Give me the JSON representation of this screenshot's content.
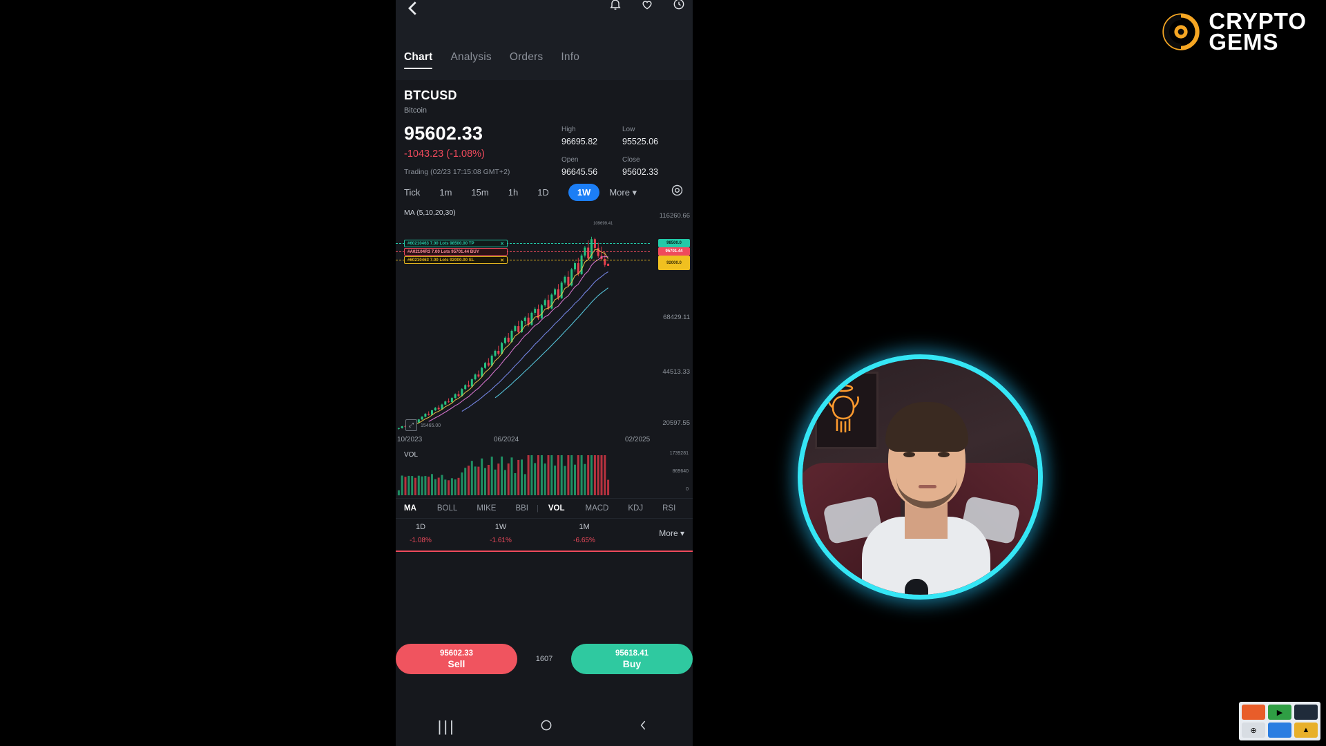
{
  "app": {
    "nav_back_icon": "chevron-left-icon",
    "top_icons": [
      "bell-icon",
      "heart-icon",
      "share-icon"
    ]
  },
  "tabs": [
    {
      "label": "Chart",
      "active": true
    },
    {
      "label": "Analysis",
      "active": false
    },
    {
      "label": "Orders",
      "active": false
    },
    {
      "label": "Info",
      "active": false
    }
  ],
  "symbol": {
    "ticker": "BTCUSD",
    "name": "Bitcoin",
    "last_price": "95602.33",
    "change": "-1043.23 (-1.08%)",
    "change_color": "#ef4a5c",
    "status": "Trading (02/23 17:15:08 GMT+2)"
  },
  "stats": {
    "high_label": "High",
    "high_value": "96695.82",
    "low_label": "Low",
    "low_value": "95525.06",
    "open_label": "Open",
    "open_value": "96645.56",
    "close_label": "Close",
    "close_value": "95602.33"
  },
  "timeframes": [
    {
      "label": "Tick",
      "active": false
    },
    {
      "label": "1m",
      "active": false
    },
    {
      "label": "15m",
      "active": false
    },
    {
      "label": "1h",
      "active": false
    },
    {
      "label": "1D",
      "active": false
    },
    {
      "label": "1W",
      "active": true
    },
    {
      "label": "More ▾",
      "active": false
    }
  ],
  "settings_icon": "gear-icon",
  "chart": {
    "ma_label": "MA (5,10,20,30)",
    "y_ticks": [
      "116260.66",
      "68429.11",
      "44513.33",
      "20597.55"
    ],
    "x_ticks": [
      "10/2023",
      "06/2024",
      "02/2025"
    ],
    "high_marker": "109699.41",
    "low_marker": "15465.00",
    "expand_icon": "expand-icon",
    "orders": [
      {
        "text": "#60210463  7.00 Lots  98500.00  TP",
        "price_tag": "98500.0",
        "type": "tp",
        "close_icon": "close-icon"
      },
      {
        "text": "#A02104R3  7.00 Lots  95701.44  BUY",
        "price_tag": "95701.44",
        "type": "buy",
        "close_icon": "close-icon"
      },
      {
        "text": "#60210463  7.00 Lots  92000.00  SL",
        "price_tag": "92000.0",
        "type": "sl",
        "close_icon": "close-icon"
      }
    ]
  },
  "volume": {
    "label": "VOL",
    "y_ticks": [
      "1739281",
      "869640",
      "0"
    ]
  },
  "indicators": [
    {
      "label": "MA",
      "active": true
    },
    {
      "label": "BOLL",
      "active": false
    },
    {
      "label": "MIKE",
      "active": false
    },
    {
      "label": "BBI",
      "active": false
    },
    {
      "label": "VOL",
      "active": true
    },
    {
      "label": "MACD",
      "active": false
    },
    {
      "label": "KDJ",
      "active": false
    },
    {
      "label": "RSI",
      "active": false
    }
  ],
  "performance": [
    {
      "period": "1D",
      "value": "-1.08%"
    },
    {
      "period": "1W",
      "value": "-1.61%"
    },
    {
      "period": "1M",
      "value": "-6.65%"
    }
  ],
  "performance_more": "More ▾",
  "actions": {
    "sell_price": "95602.33",
    "sell_label": "Sell",
    "buy_price": "95618.41",
    "buy_label": "Buy",
    "spread": "1607",
    "trend_icon": "trend-up-icon"
  },
  "system_nav": [
    "recents-icon",
    "home-icon",
    "back-icon"
  ],
  "branding": {
    "line1": "CRYPTO",
    "line2": "GEMS",
    "mark_icon": "gem-coin-icon",
    "accent": "#f5a623"
  },
  "webcam": {
    "label": "presenter-webcam",
    "ring_color": "#35e6f5"
  },
  "taskbar_icons": [
    "app-icon-1",
    "app-icon-2",
    "app-icon-3",
    "app-icon-4",
    "app-icon-5",
    "app-icon-6"
  ],
  "chart_data": {
    "type": "candlestick",
    "title": "BTCUSD 1W",
    "xlabel": "",
    "ylabel": "",
    "ylim": [
      15465.0,
      116260.66
    ],
    "y_ticks": [
      116260.66,
      68429.11,
      44513.33,
      20597.55
    ],
    "x_ticks": [
      "10/2023",
      "06/2024",
      "02/2025"
    ],
    "grid": false,
    "legend": "MA (5,10,20,30)",
    "annotations": [
      {
        "text": "109699.41",
        "type": "swing-high"
      },
      {
        "text": "15465.00",
        "type": "swing-low"
      },
      {
        "text": "TP 98500.00",
        "type": "take-profit-line"
      },
      {
        "text": "BUY 95701.44",
        "type": "entry-line"
      },
      {
        "text": "SL 92000.00",
        "type": "stop-loss-line"
      }
    ],
    "ohlc": [
      [
        16900,
        17400,
        16500,
        17200
      ],
      [
        17200,
        18300,
        17000,
        18100
      ],
      [
        18100,
        18800,
        17600,
        17900
      ],
      [
        17900,
        19200,
        17700,
        19000
      ],
      [
        19000,
        20400,
        18800,
        20200
      ],
      [
        20200,
        21000,
        19600,
        19900
      ],
      [
        19900,
        21600,
        19700,
        21400
      ],
      [
        21400,
        23000,
        21100,
        22700
      ],
      [
        22700,
        24500,
        22400,
        24100
      ],
      [
        24100,
        25300,
        23200,
        23600
      ],
      [
        23600,
        26100,
        23400,
        25800
      ],
      [
        25800,
        27400,
        25500,
        27000
      ],
      [
        27000,
        28200,
        25900,
        26300
      ],
      [
        26300,
        29000,
        26100,
        28600
      ],
      [
        28600,
        30500,
        28300,
        30100
      ],
      [
        30100,
        31600,
        29400,
        29800
      ],
      [
        29800,
        32200,
        29500,
        31800
      ],
      [
        31800,
        34000,
        31400,
        33600
      ],
      [
        33600,
        35200,
        32200,
        32700
      ],
      [
        32700,
        36500,
        32400,
        36100
      ],
      [
        36100,
        38400,
        35700,
        38000
      ],
      [
        38000,
        40100,
        36900,
        37300
      ],
      [
        37300,
        41200,
        37000,
        40800
      ],
      [
        40800,
        43600,
        40300,
        43100
      ],
      [
        43100,
        45000,
        41600,
        42100
      ],
      [
        42100,
        46800,
        41800,
        46300
      ],
      [
        46300,
        49200,
        45800,
        48700
      ],
      [
        48700,
        51000,
        46900,
        47400
      ],
      [
        47400,
        52800,
        47100,
        52200
      ],
      [
        52200,
        55100,
        51600,
        54500
      ],
      [
        54500,
        57000,
        52300,
        53100
      ],
      [
        53100,
        58900,
        52800,
        58300
      ],
      [
        58300,
        61500,
        57700,
        60900
      ],
      [
        60900,
        63200,
        58100,
        58900
      ],
      [
        58900,
        64800,
        58500,
        64200
      ],
      [
        64200,
        67100,
        63500,
        66500
      ],
      [
        66500,
        69000,
        62900,
        63600
      ],
      [
        63600,
        69500,
        63200,
        68900
      ],
      [
        68900,
        71200,
        67400,
        70600
      ],
      [
        70600,
        72800,
        66300,
        67100
      ],
      [
        67100,
        73500,
        66700,
        72900
      ],
      [
        72900,
        75600,
        71800,
        74800
      ],
      [
        74800,
        76900,
        69500,
        70300
      ],
      [
        70300,
        77200,
        69900,
        76500
      ],
      [
        76500,
        79800,
        75700,
        79100
      ],
      [
        79100,
        81600,
        74200,
        75000
      ],
      [
        75000,
        82400,
        74600,
        81700
      ],
      [
        81700,
        85000,
        80900,
        84300
      ],
      [
        84300,
        86800,
        79100,
        80000
      ],
      [
        80000,
        88200,
        79600,
        87500
      ],
      [
        87500,
        91000,
        86600,
        90300
      ],
      [
        90300,
        93100,
        85200,
        86100
      ],
      [
        86100,
        94600,
        85700,
        93900
      ],
      [
        93900,
        97800,
        92800,
        96900
      ],
      [
        96900,
        99500,
        90700,
        91600
      ],
      [
        91600,
        101400,
        91200,
        100600
      ],
      [
        100600,
        105200,
        99700,
        104400
      ],
      [
        104400,
        107900,
        98300,
        99200
      ],
      [
        99200,
        109699,
        98800,
        108500
      ],
      [
        108500,
        109200,
        103400,
        104300
      ],
      [
        104300,
        106800,
        99500,
        100400
      ],
      [
        100400,
        104900,
        98200,
        98900
      ],
      [
        98900,
        102300,
        95100,
        96000
      ],
      [
        96645,
        96695,
        95525,
        95602
      ]
    ],
    "ma_periods": [
      5,
      10,
      20,
      30
    ],
    "volume": {
      "label": "VOL",
      "y_ticks": [
        0,
        869640,
        1739281
      ]
    }
  }
}
